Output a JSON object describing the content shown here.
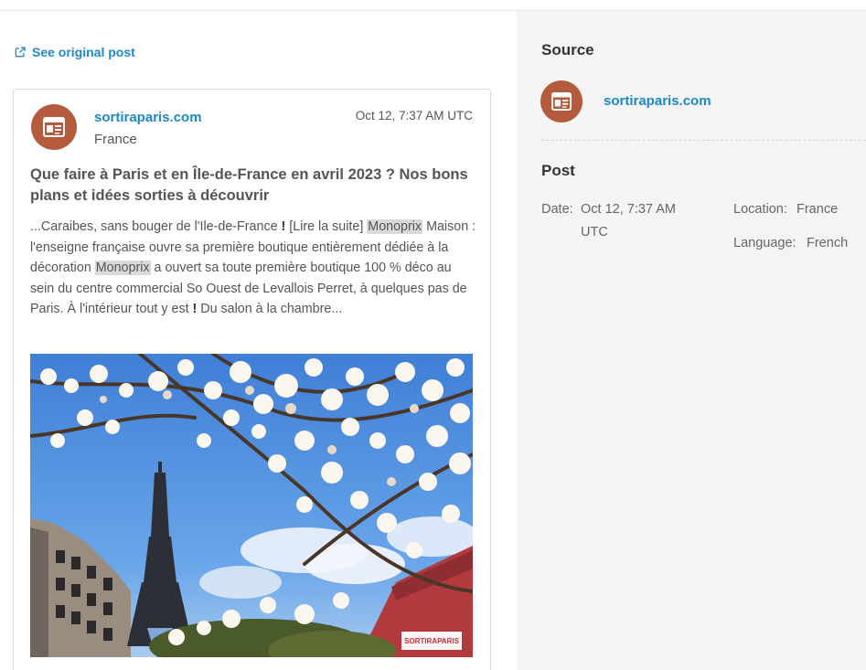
{
  "left": {
    "see_original": "See original post"
  },
  "card": {
    "source_name": "sortiraparis.com",
    "country": "France",
    "date": "Oct 12, 7:37 AM UTC",
    "headline": "Que faire à Paris et en Île-de-France en avril 2023 ? Nos bons plans et idées sorties à découvrir",
    "excerpt": {
      "p1": "...Caraibes, sans bouger de l'Ile-de-France ",
      "bang1": "!",
      "p2": " [Lire la suite] ",
      "hl1": "Monoprix",
      "p3": " Maison : l'enseigne française ouvre sa première boutique entièrement dédiée à la décoration ",
      "hl2": "Monoprix",
      "p4": " a ouvert sa toute première boutique 100 % déco au sein du centre commercial So Ouest de Levallois Perret, à quelques pas de Paris. À l'intérieur tout y est ",
      "bang2": "!",
      "p5": " Du salon à la chambre..."
    },
    "watermark_text": "SORTIRAPARIS"
  },
  "right": {
    "source_title": "Source",
    "source_name": "sortiraparis.com",
    "post_title": "Post",
    "date_label": "Date:",
    "date_value_line1": "Oct 12, 7:37 AM",
    "date_value_line2": "UTC",
    "location_label": "Location:",
    "location_value": "France",
    "language_label": "Language:",
    "language_value": "French"
  },
  "colors": {
    "link": "#1e88c8",
    "avatar": "#b45b3d",
    "sidebar_bg": "#f4f4f4",
    "highlight": "#d9d9d9"
  },
  "icons": {
    "external_link": "external-link-icon",
    "news_source": "newspaper-icon"
  }
}
